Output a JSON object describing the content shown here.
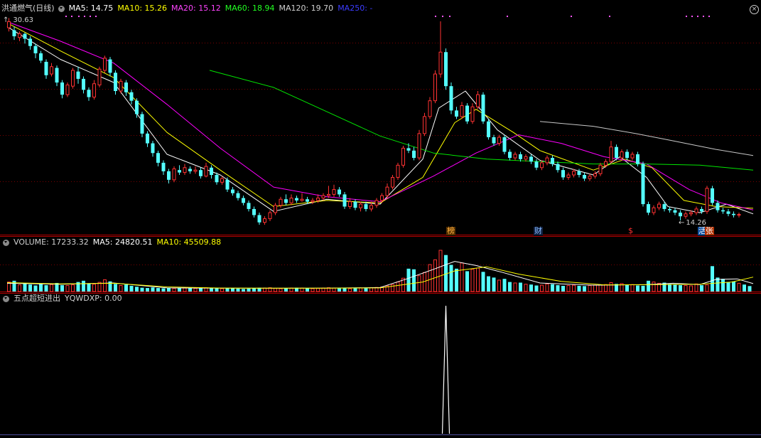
{
  "main_header": {
    "title": "洪通燃气(日线)",
    "ma5": "MA5: 14.75",
    "ma10": "MA10: 15.26",
    "ma20": "MA20: 15.12",
    "ma60": "MA60: 18.94",
    "ma120": "MA120: 19.70",
    "ma250": "MA250: -"
  },
  "price_labels": {
    "high": "30.63",
    "low": "14.26"
  },
  "event_markers": {
    "m1": "榜",
    "m2": "财",
    "m3": "$",
    "m4": "活",
    "m5": "张"
  },
  "volume_header": {
    "volume": "VOLUME: 17233.32",
    "ma5": "MA5: 24820.51",
    "ma10": "MA10: 45509.88"
  },
  "indicator_header": {
    "name": "五点超短进出",
    "value": "YQWDXP: 0.00"
  },
  "colors": {
    "up": "#ff3232",
    "down": "#54ffff",
    "ma5": "#ffffff",
    "ma10": "#ffff00",
    "ma20": "#ff00ff",
    "ma60": "#00e600",
    "ma120": "#c8c8c8",
    "ma250": "#3c3cff",
    "grid": "#7a0000"
  },
  "chart_data": {
    "type": "candlestick",
    "price_range": [
      14.26,
      30.63
    ],
    "highlight_max": 30.63,
    "highlight_min": 14.26,
    "candles": [
      [
        30.1,
        30.6,
        30.9,
        29.8
      ],
      [
        29.9,
        29.4,
        30.2,
        29.1
      ],
      [
        29.3,
        29.6,
        29.8,
        29.0
      ],
      [
        29.6,
        29.2,
        29.7,
        28.8
      ],
      [
        29.2,
        28.6,
        29.4,
        28.3
      ],
      [
        28.6,
        28.0,
        28.8,
        27.6
      ],
      [
        28.0,
        27.4,
        28.2,
        27.2
      ],
      [
        27.3,
        26.2,
        27.5,
        25.9
      ],
      [
        26.3,
        26.9,
        27.2,
        26.1
      ],
      [
        26.8,
        25.6,
        27.0,
        25.3
      ],
      [
        25.6,
        24.6,
        25.8,
        24.3
      ],
      [
        24.6,
        25.4,
        25.6,
        24.4
      ],
      [
        25.3,
        26.6,
        26.8,
        25.1
      ],
      [
        26.5,
        25.9,
        26.9,
        25.5
      ],
      [
        25.9,
        25.0,
        26.1,
        24.7
      ],
      [
        25.0,
        24.4,
        25.2,
        24.1
      ],
      [
        24.4,
        25.5,
        25.8,
        24.2
      ],
      [
        25.4,
        26.7,
        26.9,
        25.2
      ],
      [
        26.6,
        27.6,
        27.8,
        26.4
      ],
      [
        27.5,
        26.4,
        27.7,
        26.1
      ],
      [
        26.4,
        24.9,
        26.6,
        24.6
      ],
      [
        24.9,
        25.7,
        25.9,
        24.7
      ],
      [
        25.6,
        24.8,
        25.8,
        24.5
      ],
      [
        24.8,
        24.1,
        25.0,
        23.8
      ],
      [
        24.1,
        23.0,
        24.3,
        22.7
      ],
      [
        23.0,
        21.4,
        23.2,
        21.1
      ],
      [
        21.4,
        20.6,
        21.6,
        20.3
      ],
      [
        20.6,
        19.8,
        20.8,
        19.5
      ],
      [
        19.8,
        19.0,
        20.0,
        18.7
      ],
      [
        19.0,
        18.3,
        19.2,
        18.0
      ],
      [
        18.3,
        17.6,
        18.5,
        17.3
      ],
      [
        17.6,
        18.5,
        18.7,
        17.4
      ],
      [
        18.4,
        18.2,
        18.8,
        18.0
      ],
      [
        18.2,
        18.6,
        18.9,
        18.0
      ],
      [
        18.5,
        18.3,
        18.7,
        18.1
      ],
      [
        18.3,
        18.4,
        18.7,
        18.1
      ],
      [
        18.4,
        17.9,
        18.6,
        17.7
      ],
      [
        17.9,
        18.7,
        19.0,
        17.8
      ],
      [
        18.6,
        18.0,
        18.8,
        17.7
      ],
      [
        18.0,
        17.4,
        18.2,
        17.2
      ],
      [
        17.4,
        17.7,
        17.9,
        17.2
      ],
      [
        17.6,
        16.8,
        17.8,
        16.6
      ],
      [
        16.8,
        16.5,
        17.0,
        16.3
      ],
      [
        16.5,
        16.1,
        16.7,
        15.9
      ],
      [
        16.1,
        15.7,
        16.3,
        15.5
      ],
      [
        15.7,
        15.2,
        15.9,
        15.0
      ],
      [
        15.2,
        14.7,
        15.4,
        14.5
      ],
      [
        14.7,
        14.1,
        14.9,
        13.9
      ],
      [
        14.1,
        14.4,
        14.6,
        13.9
      ],
      [
        14.4,
        14.9,
        15.1,
        14.2
      ],
      [
        14.9,
        15.5,
        15.7,
        14.7
      ],
      [
        15.5,
        16.0,
        16.2,
        15.3
      ],
      [
        16.0,
        15.7,
        16.4,
        15.5
      ],
      [
        15.7,
        16.1,
        16.4,
        15.5
      ],
      [
        16.1,
        15.9,
        16.3,
        15.7
      ],
      [
        15.9,
        16.0,
        16.5,
        15.8
      ],
      [
        16.0,
        15.8,
        16.2,
        15.6
      ],
      [
        15.8,
        15.9,
        16.1,
        15.6
      ],
      [
        15.9,
        16.1,
        16.4,
        15.7
      ],
      [
        16.1,
        16.3,
        16.5,
        15.9
      ],
      [
        16.3,
        16.4,
        17.1,
        16.1
      ],
      [
        16.4,
        16.8,
        17.2,
        16.2
      ],
      [
        16.8,
        16.4,
        17.0,
        16.2
      ],
      [
        16.4,
        15.4,
        16.6,
        15.2
      ],
      [
        15.4,
        15.8,
        16.1,
        15.2
      ],
      [
        15.8,
        15.3,
        16.0,
        15.1
      ],
      [
        15.3,
        15.6,
        15.8,
        15.0
      ],
      [
        15.6,
        15.2,
        15.8,
        15.0
      ],
      [
        15.2,
        15.5,
        15.8,
        15.0
      ],
      [
        15.5,
        15.9,
        16.1,
        15.3
      ],
      [
        15.9,
        16.3,
        16.5,
        15.7
      ],
      [
        16.3,
        17.0,
        17.3,
        16.1
      ],
      [
        17.0,
        17.8,
        18.0,
        16.8
      ],
      [
        17.8,
        18.8,
        19.0,
        17.6
      ],
      [
        18.8,
        20.2,
        20.4,
        18.6
      ],
      [
        20.2,
        20.0,
        20.6,
        19.8
      ],
      [
        20.0,
        19.4,
        20.3,
        19.2
      ],
      [
        19.4,
        21.4,
        21.7,
        19.2
      ],
      [
        21.4,
        22.8,
        23.1,
        21.2
      ],
      [
        22.8,
        24.1,
        24.4,
        22.6
      ],
      [
        24.1,
        26.3,
        26.6,
        23.9
      ],
      [
        26.3,
        28.1,
        30.63,
        26.0
      ],
      [
        28.1,
        25.3,
        28.4,
        25.0
      ],
      [
        25.3,
        23.3,
        25.6,
        23.0
      ],
      [
        23.3,
        22.8,
        23.6,
        22.6
      ],
      [
        22.8,
        23.7,
        24.0,
        22.6
      ],
      [
        23.7,
        22.4,
        23.9,
        22.2
      ],
      [
        22.4,
        23.6,
        23.9,
        22.2
      ],
      [
        23.6,
        24.6,
        24.9,
        23.4
      ],
      [
        24.6,
        22.4,
        24.8,
        22.2
      ],
      [
        22.4,
        21.1,
        22.6,
        20.9
      ],
      [
        21.1,
        20.6,
        21.3,
        20.4
      ],
      [
        20.6,
        21.1,
        21.3,
        20.4
      ],
      [
        21.1,
        19.9,
        21.3,
        19.7
      ],
      [
        19.9,
        19.4,
        20.1,
        19.2
      ],
      [
        19.4,
        19.7,
        19.9,
        19.2
      ],
      [
        19.7,
        19.3,
        19.9,
        19.1
      ],
      [
        19.3,
        19.5,
        19.7,
        19.1
      ],
      [
        19.5,
        19.1,
        19.7,
        18.9
      ],
      [
        19.1,
        18.6,
        19.3,
        18.4
      ],
      [
        18.6,
        19.0,
        19.2,
        18.4
      ],
      [
        19.0,
        19.4,
        19.6,
        18.8
      ],
      [
        19.4,
        18.9,
        19.6,
        18.7
      ],
      [
        18.9,
        18.4,
        19.1,
        18.2
      ],
      [
        18.4,
        17.8,
        18.6,
        17.6
      ],
      [
        17.8,
        18.0,
        18.2,
        17.6
      ],
      [
        18.0,
        18.3,
        18.5,
        17.8
      ],
      [
        18.3,
        18.0,
        18.5,
        17.8
      ],
      [
        18.0,
        17.7,
        18.2,
        17.5
      ],
      [
        17.7,
        17.9,
        18.1,
        17.5
      ],
      [
        17.9,
        18.1,
        18.3,
        17.7
      ],
      [
        18.1,
        18.8,
        19.0,
        17.9
      ],
      [
        18.8,
        19.1,
        19.3,
        18.6
      ],
      [
        19.1,
        20.3,
        20.8,
        18.9
      ],
      [
        20.3,
        19.4,
        20.5,
        19.2
      ],
      [
        19.4,
        19.9,
        20.1,
        19.2
      ],
      [
        19.9,
        19.4,
        20.1,
        19.2
      ],
      [
        19.4,
        19.7,
        19.9,
        19.2
      ],
      [
        19.7,
        18.9,
        19.9,
        18.7
      ],
      [
        18.9,
        15.6,
        19.1,
        15.4
      ],
      [
        15.6,
        14.9,
        15.8,
        14.7
      ],
      [
        14.9,
        15.3,
        15.5,
        14.7
      ],
      [
        15.3,
        15.6,
        15.8,
        15.1
      ],
      [
        15.6,
        15.2,
        15.8,
        15.0
      ],
      [
        15.2,
        15.1,
        15.4,
        14.9
      ],
      [
        15.1,
        14.9,
        15.3,
        14.7
      ],
      [
        14.9,
        14.6,
        15.1,
        14.26
      ],
      [
        14.6,
        14.8,
        15.0,
        14.4
      ],
      [
        14.8,
        14.9,
        15.1,
        14.6
      ],
      [
        14.9,
        15.2,
        15.4,
        14.7
      ],
      [
        15.2,
        15.0,
        15.4,
        14.8
      ],
      [
        15.0,
        16.9,
        17.1,
        14.8
      ],
      [
        16.9,
        15.7,
        17.1,
        15.5
      ],
      [
        15.7,
        15.1,
        15.9,
        14.9
      ],
      [
        15.1,
        15.0,
        15.3,
        14.8
      ],
      [
        15.0,
        14.8,
        15.2,
        14.6
      ],
      [
        14.8,
        14.7,
        15.0,
        14.5
      ],
      [
        14.7,
        14.75,
        14.9,
        14.5
      ]
    ],
    "ma_series": {
      "ma5": [
        [
          0,
          30.2
        ],
        [
          10,
          27.5
        ],
        [
          20,
          25.6
        ],
        [
          30,
          19.7
        ],
        [
          40,
          18.0
        ],
        [
          50,
          15.0
        ],
        [
          60,
          16.0
        ],
        [
          70,
          15.6
        ],
        [
          78,
          19.3
        ],
        [
          81,
          23.5
        ],
        [
          86,
          24.9
        ],
        [
          92,
          21.7
        ],
        [
          100,
          19.2
        ],
        [
          110,
          18.0
        ],
        [
          115,
          19.5
        ],
        [
          120,
          17.8
        ],
        [
          124,
          15.4
        ],
        [
          130,
          14.9
        ],
        [
          135,
          15.6
        ],
        [
          140,
          14.8
        ]
      ],
      "ma10": [
        [
          0,
          30.5
        ],
        [
          10,
          28.2
        ],
        [
          20,
          26.0
        ],
        [
          30,
          21.5
        ],
        [
          40,
          18.4
        ],
        [
          50,
          15.4
        ],
        [
          60,
          15.9
        ],
        [
          70,
          15.7
        ],
        [
          78,
          17.8
        ],
        [
          84,
          22.3
        ],
        [
          88,
          23.4
        ],
        [
          95,
          21.5
        ],
        [
          100,
          20.0
        ],
        [
          110,
          18.4
        ],
        [
          116,
          19.3
        ],
        [
          121,
          18.6
        ],
        [
          127,
          15.9
        ],
        [
          133,
          15.4
        ],
        [
          140,
          15.26
        ]
      ],
      "ma20": [
        [
          0,
          30.6
        ],
        [
          10,
          29.0
        ],
        [
          20,
          27.2
        ],
        [
          30,
          23.8
        ],
        [
          40,
          20.2
        ],
        [
          50,
          17.0
        ],
        [
          60,
          16.2
        ],
        [
          70,
          15.8
        ],
        [
          80,
          17.9
        ],
        [
          88,
          19.8
        ],
        [
          96,
          21.3
        ],
        [
          104,
          20.6
        ],
        [
          112,
          19.5
        ],
        [
          120,
          18.9
        ],
        [
          128,
          16.8
        ],
        [
          134,
          15.7
        ],
        [
          140,
          15.12
        ]
      ],
      "ma60": [
        [
          38,
          26.6
        ],
        [
          50,
          25.2
        ],
        [
          60,
          23.2
        ],
        [
          70,
          21.2
        ],
        [
          80,
          19.8
        ],
        [
          90,
          19.3
        ],
        [
          100,
          19.1
        ],
        [
          110,
          18.9
        ],
        [
          120,
          18.9
        ],
        [
          130,
          18.8
        ],
        [
          140,
          18.4
        ]
      ],
      "ma120": [
        [
          100,
          22.4
        ],
        [
          110,
          22.0
        ],
        [
          118,
          21.4
        ],
        [
          125,
          20.8
        ],
        [
          133,
          20.1
        ],
        [
          140,
          19.6
        ]
      ]
    },
    "events": [
      {
        "index": 81,
        "label": "榜"
      },
      {
        "index": 97,
        "label": "财"
      },
      {
        "index": 114,
        "label": "$"
      },
      {
        "index": 128,
        "label": "活"
      },
      {
        "index": 129,
        "label": "张"
      }
    ],
    "volume": {
      "max": 130000,
      "values": [
        30000,
        34000,
        21000,
        26000,
        22000,
        19000,
        24000,
        20000,
        22000,
        27000,
        20000,
        19000,
        21000,
        30000,
        34000,
        26000,
        23000,
        29000,
        37000,
        32000,
        24000,
        19000,
        22000,
        18000,
        15000,
        12000,
        11000,
        13000,
        11000,
        10000,
        12000,
        10000,
        12000,
        11000,
        10000,
        10000,
        11000,
        12000,
        11000,
        10000,
        9000,
        10000,
        11000,
        9000,
        8000,
        9000,
        10000,
        12000,
        11000,
        12000,
        10000,
        9000,
        10000,
        11000,
        12000,
        11000,
        10000,
        9000,
        10000,
        11000,
        12000,
        11000,
        10000,
        11000,
        9000,
        10000,
        11000,
        10000,
        12000,
        13000,
        14000,
        18000,
        22000,
        30000,
        42000,
        72000,
        70000,
        50000,
        60000,
        85000,
        100000,
        130000,
        115000,
        84000,
        72000,
        90000,
        64000,
        70000,
        74000,
        62000,
        48000,
        44000,
        36000,
        40000,
        30000,
        27000,
        28000,
        23000,
        22000,
        19000,
        20000,
        24000,
        23000,
        20000,
        18000,
        19000,
        20000,
        18000,
        17000,
        19000,
        20000,
        21000,
        22000,
        28000,
        24000,
        25000,
        20000,
        22000,
        19000,
        18000,
        34000,
        30000,
        26000,
        28000,
        24000,
        22000,
        20000,
        19000,
        18000,
        24000,
        20000,
        21000,
        80000,
        44000,
        40000,
        30000,
        32000,
        26000,
        22000,
        17233
      ],
      "ma5": [
        [
          0,
          26000
        ],
        [
          10,
          23000
        ],
        [
          20,
          27000
        ],
        [
          30,
          11500
        ],
        [
          40,
          10500
        ],
        [
          50,
          10400
        ],
        [
          60,
          10800
        ],
        [
          70,
          12500
        ],
        [
          75,
          40000
        ],
        [
          80,
          70000
        ],
        [
          84,
          95000
        ],
        [
          88,
          82000
        ],
        [
          93,
          60000
        ],
        [
          100,
          27000
        ],
        [
          110,
          20000
        ],
        [
          120,
          22000
        ],
        [
          125,
          26000
        ],
        [
          130,
          22000
        ],
        [
          133,
          38000
        ],
        [
          137,
          40000
        ],
        [
          140,
          24820
        ]
      ],
      "ma10": [
        [
          0,
          28000
        ],
        [
          10,
          24000
        ],
        [
          20,
          26000
        ],
        [
          30,
          14500
        ],
        [
          40,
          11000
        ],
        [
          50,
          10500
        ],
        [
          60,
          10600
        ],
        [
          70,
          11500
        ],
        [
          78,
          30000
        ],
        [
          84,
          65000
        ],
        [
          90,
          78000
        ],
        [
          96,
          55000
        ],
        [
          104,
          32000
        ],
        [
          112,
          21000
        ],
        [
          120,
          21500
        ],
        [
          130,
          23000
        ],
        [
          136,
          30000
        ],
        [
          140,
          45509
        ]
      ]
    },
    "indicator": {
      "name": "YQWDXP",
      "spike_index": 82,
      "spike_value": 1,
      "current_value": 0.0
    }
  }
}
